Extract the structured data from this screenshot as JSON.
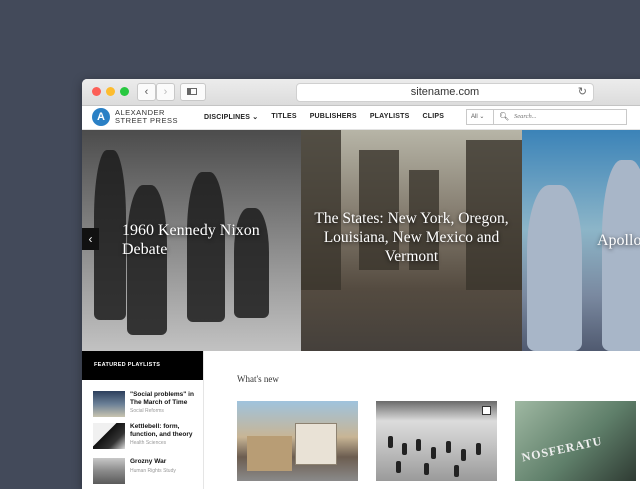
{
  "browser": {
    "url": "sitename.com",
    "back": "‹",
    "forward": "›",
    "reload": "↻"
  },
  "site": {
    "logo_letter": "A",
    "logo_line1": "ALEXANDER",
    "logo_line2": "STREET PRESS",
    "nav": [
      "DISCIPLINES ⌄",
      "TITLES",
      "PUBLISHERS",
      "PLAYLISTS",
      "CLIPS"
    ],
    "search": {
      "select": "All ⌄",
      "placeholder": "Search..."
    }
  },
  "hero": {
    "slides": [
      {
        "title": "1960 Kennedy Nixon Debate"
      },
      {
        "title": "The States: New York, Oregon, Louisiana, New Mexico and Vermont"
      },
      {
        "title": "Apollo"
      }
    ],
    "prev": "‹"
  },
  "sidebar": {
    "heading": "FEATURED PLAYLISTS",
    "items": [
      {
        "title": "\"Social problems\" in The March of Time",
        "category": "Social Reforms"
      },
      {
        "title": "Kettlebell: form, function, and theory",
        "category": "Health Sciences"
      },
      {
        "title": "Grozny War",
        "category": "Human Rights Study"
      }
    ]
  },
  "main": {
    "heading": "What's new",
    "card3_text": "NOSFERATU"
  }
}
